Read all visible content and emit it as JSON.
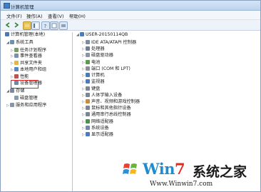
{
  "window": {
    "title": "计算机管理"
  },
  "menu": [
    "文件(F)",
    "操作(A)",
    "查看(V)",
    "帮助(H)"
  ],
  "left_tree": [
    {
      "label": "计算机管理(本地)",
      "level": 0,
      "expander": "",
      "icon": "computer-management-icon",
      "color": "#4a78b5"
    },
    {
      "label": "系统工具",
      "level": 1,
      "expander": "◢",
      "icon": "system-tools-icon",
      "color": "#6f8fb3"
    },
    {
      "label": "任务计划程序",
      "level": 2,
      "expander": "▷",
      "icon": "task-scheduler-icon",
      "color": "#7a9b6a"
    },
    {
      "label": "事件查看器",
      "level": 2,
      "expander": "▷",
      "icon": "event-viewer-icon",
      "color": "#7e8fa8"
    },
    {
      "label": "共享文件夹",
      "level": 2,
      "expander": "▷",
      "icon": "shared-folders-icon",
      "color": "#e0b84a"
    },
    {
      "label": "本地用户和组",
      "level": 2,
      "expander": "▷",
      "icon": "users-groups-icon",
      "color": "#5b86c4"
    },
    {
      "label": "性能",
      "level": 2,
      "expander": "▷",
      "icon": "performance-icon",
      "color": "#c0504d"
    },
    {
      "label": "设备管理器",
      "level": 2,
      "expander": "",
      "icon": "device-manager-icon",
      "color": "#6d88a8"
    },
    {
      "label": "存储",
      "level": 1,
      "expander": "◢",
      "icon": "storage-icon",
      "color": "#7b8aa0"
    },
    {
      "label": "磁盘管理",
      "level": 2,
      "expander": "",
      "icon": "disk-management-icon",
      "color": "#8d9aa9"
    },
    {
      "label": "服务和应用程序",
      "level": 1,
      "expander": "▷",
      "icon": "services-apps-icon",
      "color": "#8895a6"
    }
  ],
  "device_tree": {
    "root": "USER-20150114QB",
    "items": [
      {
        "label": "IDE ATA/ATAPI 控制器",
        "icon": "ide-controller-icon",
        "color": "#7d8ca0"
      },
      {
        "label": "处理器",
        "icon": "processor-icon",
        "color": "#6f7f92"
      },
      {
        "label": "磁盘驱动器",
        "icon": "disk-drive-icon",
        "color": "#8a96a5"
      },
      {
        "label": "电池",
        "icon": "battery-icon",
        "color": "#5d9a4a"
      },
      {
        "label": "端口 (COM 和 LPT)",
        "icon": "port-icon",
        "color": "#8a8f96"
      },
      {
        "label": "计算机",
        "icon": "computer-icon",
        "color": "#4b7bbf"
      },
      {
        "label": "监视器",
        "icon": "monitor-icon",
        "color": "#4b7bbf"
      },
      {
        "label": "键盘",
        "icon": "keyboard-icon",
        "color": "#7d8590"
      },
      {
        "label": "人体学输入设备",
        "icon": "hid-icon",
        "color": "#7d8590"
      },
      {
        "label": "声音、视频和游戏控制器",
        "icon": "sound-icon",
        "color": "#c98b3a"
      },
      {
        "label": "鼠标和其他指针设备",
        "icon": "mouse-icon",
        "color": "#7d8590"
      },
      {
        "label": "通用串行总线控制器",
        "icon": "usb-icon",
        "color": "#7d8590"
      },
      {
        "label": "网络适配器",
        "icon": "network-adapter-icon",
        "color": "#4e8f4e"
      },
      {
        "label": "系统设备",
        "icon": "system-device-icon",
        "color": "#6f88a8"
      },
      {
        "label": "显示适配器",
        "icon": "display-adapter-icon",
        "color": "#4b7bbf"
      }
    ]
  },
  "watermark": {
    "brand_prefix": "Win",
    "brand_digit": "7",
    "brand_cn": "系统之家",
    "url": "Www.Winwin7.com"
  },
  "colors": {
    "title_gradient_top": "#d6e5f7",
    "selection_outline": "#d8262b",
    "watermark_blue": "#1f8ccf",
    "watermark_red": "#e5281f"
  }
}
